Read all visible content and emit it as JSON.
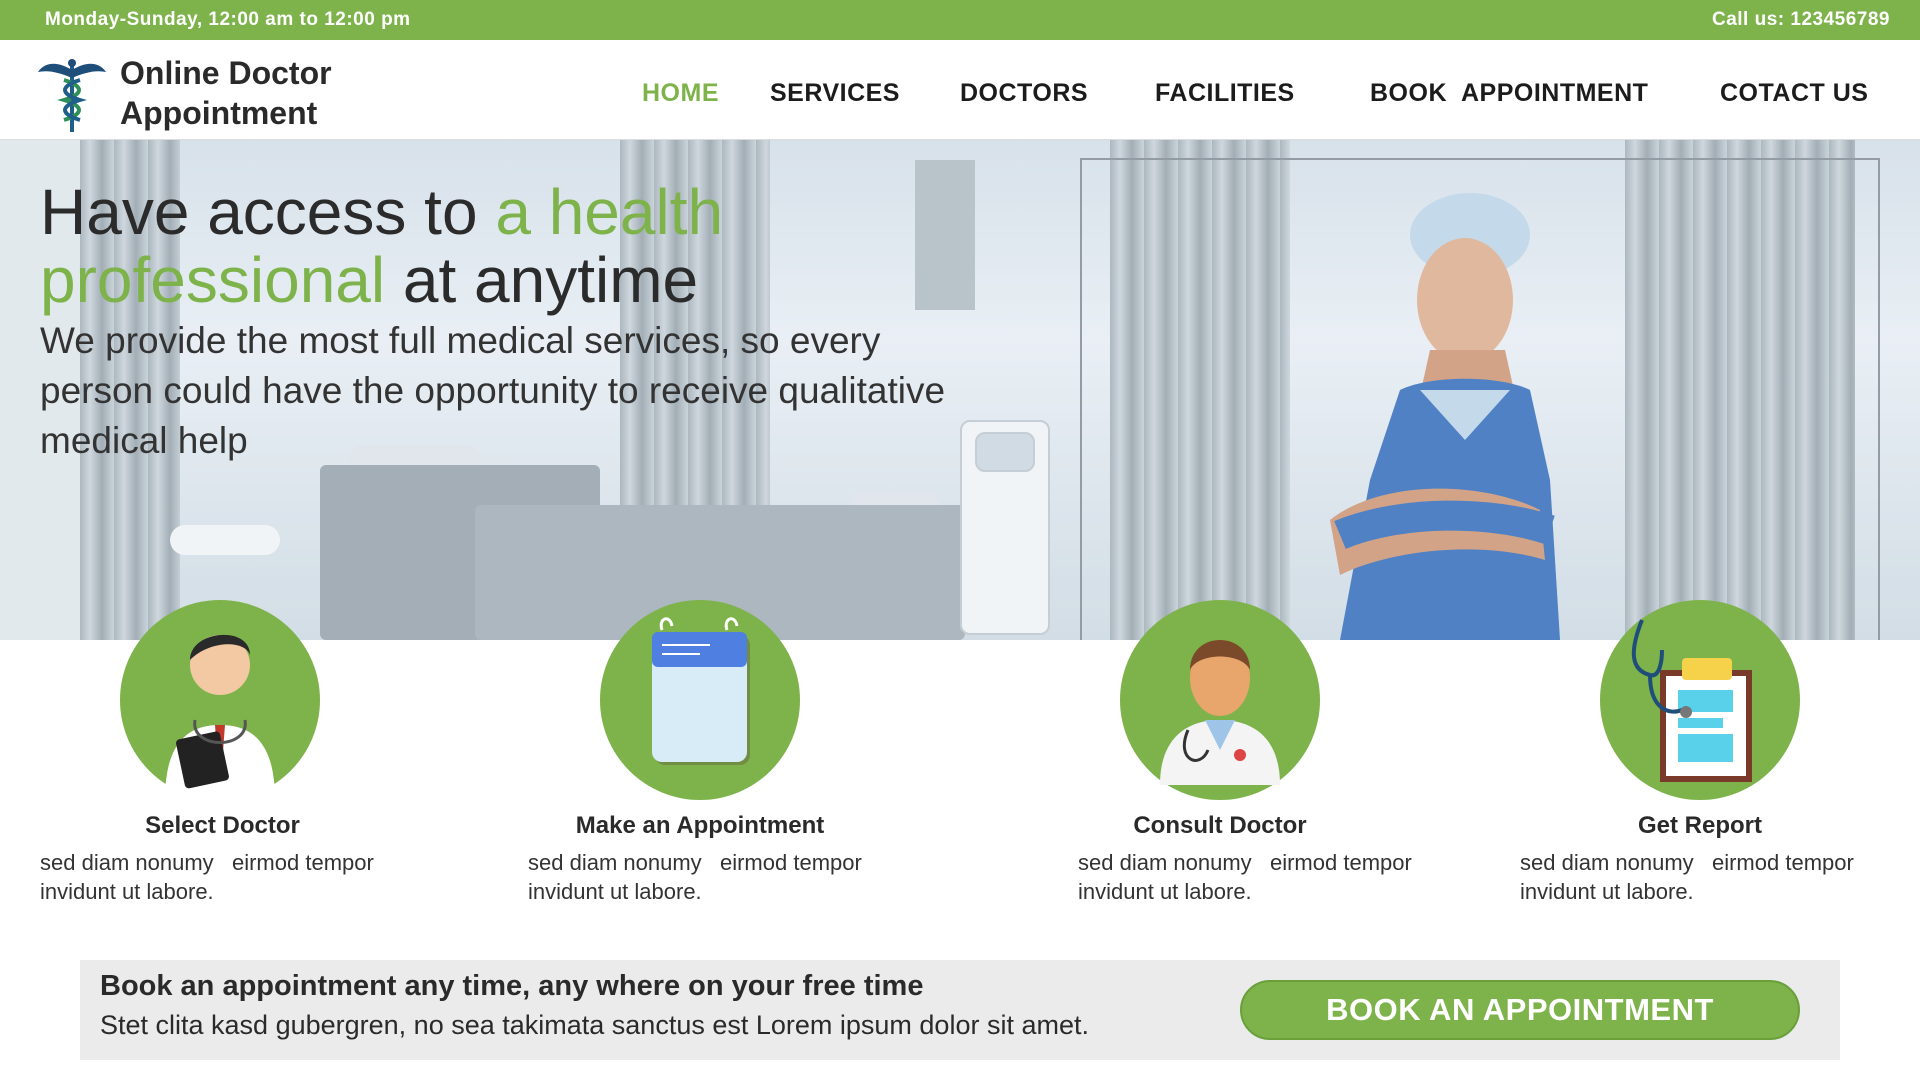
{
  "topbar": {
    "hours": "Monday-Sunday, 12:00 am to 12:00 pm",
    "phone": "Call us: 123456789"
  },
  "header": {
    "brand_line1": "Online Doctor",
    "brand_line2": "Appointment",
    "nav": [
      "HOME",
      "SERVICES",
      "DOCTORS",
      "FACILITIES",
      "BOOK  APPOINTMENT",
      "COTACT US"
    ],
    "active_nav": "HOME"
  },
  "hero": {
    "headline_part1": "Have access to ",
    "headline_highlight1": "a health",
    "headline_highlight2": "professional",
    "headline_part2": " at anytime",
    "subtext": "We provide the most full medical services, so every person could have the opportunity to receive qualitative medical help"
  },
  "steps": [
    {
      "title": "Select Doctor",
      "line1": "sed diam nonumy   eirmod tempor",
      "line2": "invidunt ut labore.",
      "icon": "doctor-with-clipboard-icon"
    },
    {
      "title": "Make an Appointment",
      "line1": "sed diam nonumy   eirmod tempor",
      "line2": "invidunt ut labore.",
      "icon": "calendar-icon"
    },
    {
      "title": "Consult Doctor",
      "line1": "sed diam nonumy   eirmod tempor",
      "line2": "invidunt ut labore.",
      "icon": "doctor-avatar-icon"
    },
    {
      "title": "Get Report",
      "line1": "sed diam nonumy   eirmod tempor",
      "line2": "invidunt ut labore.",
      "icon": "stethoscope-report-icon"
    }
  ],
  "cta": {
    "title": "Book an appointment any time, any where on your free time",
    "text": "Stet clita kasd gubergren, no sea takimata sanctus est Lorem ipsum dolor sit amet.",
    "button": "BOOK AN APPOINTMENT"
  },
  "colors": {
    "accent": "#7db34a",
    "text": "#2a2a2a",
    "cta_bg": "#ebebeb"
  }
}
